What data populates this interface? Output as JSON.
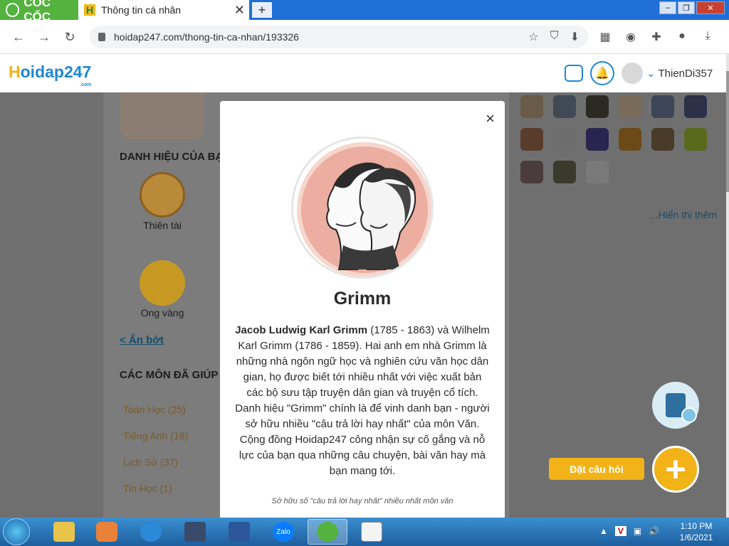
{
  "browser": {
    "brand": "CỐC CỐC",
    "tab_title": "Thông tin cá nhân",
    "new_tab": "+",
    "url": "hoidap247.com/thong-tin-ca-nhan/193326"
  },
  "site": {
    "logo_h": "H",
    "logo_rest": "oidap247",
    "logo_sub": ".com",
    "username": "ThienDi357"
  },
  "profile": {
    "titles_heading": "DANH HIỆU CỦA BẠ",
    "badges": [
      {
        "label": "Thiên tài"
      },
      {
        "label": "Ong vàng"
      }
    ],
    "show_less": "< Ẩn bớt",
    "subjects_heading": "CÁC MÔN ĐÃ GIÚP",
    "subjects": [
      "Toán Học (25)",
      "Tiếng Anh (18)",
      "Lịch Sử (37)",
      "Tin Học (1)"
    ],
    "show_more": "...Hiển thị thêm"
  },
  "ask_button": "Đặt câu hỏi",
  "modal": {
    "close": "×",
    "title": "Grimm",
    "desc_bold": "Jacob Ludwig Karl Grimm",
    "desc_rest": " (1785 - 1863) và Wilhelm Karl Grimm (1786 - 1859). Hai anh em nhà Grimm là những nhà ngôn ngữ học và nghiên cứu văn học dân gian, họ được biết tới nhiều nhất với việc xuất bản các bộ sưu tập truyện dân gian và truyện cổ tích. Danh hiệu \"Grimm\" chính là để vinh danh bạn - người sở hữu nhiều \"câu trả lời hay nhất\" của môn Văn. Cộng đồng Hoidap247 công nhận sự cố gắng và nỗ lực của bạn qua những câu chuyện, bài văn hay mà bạn mang tới.",
    "footnote": "Sở hữu số \"câu trả lời hay nhất\" nhiều nhất môn văn"
  },
  "taskbar": {
    "time": "1:10 PM",
    "date": "1/6/2021",
    "zalo": "Zalo"
  },
  "colors": {
    "brand_blue": "#1e88d4",
    "brand_yellow": "#f2b319",
    "coccoc_green": "#53b33e"
  }
}
